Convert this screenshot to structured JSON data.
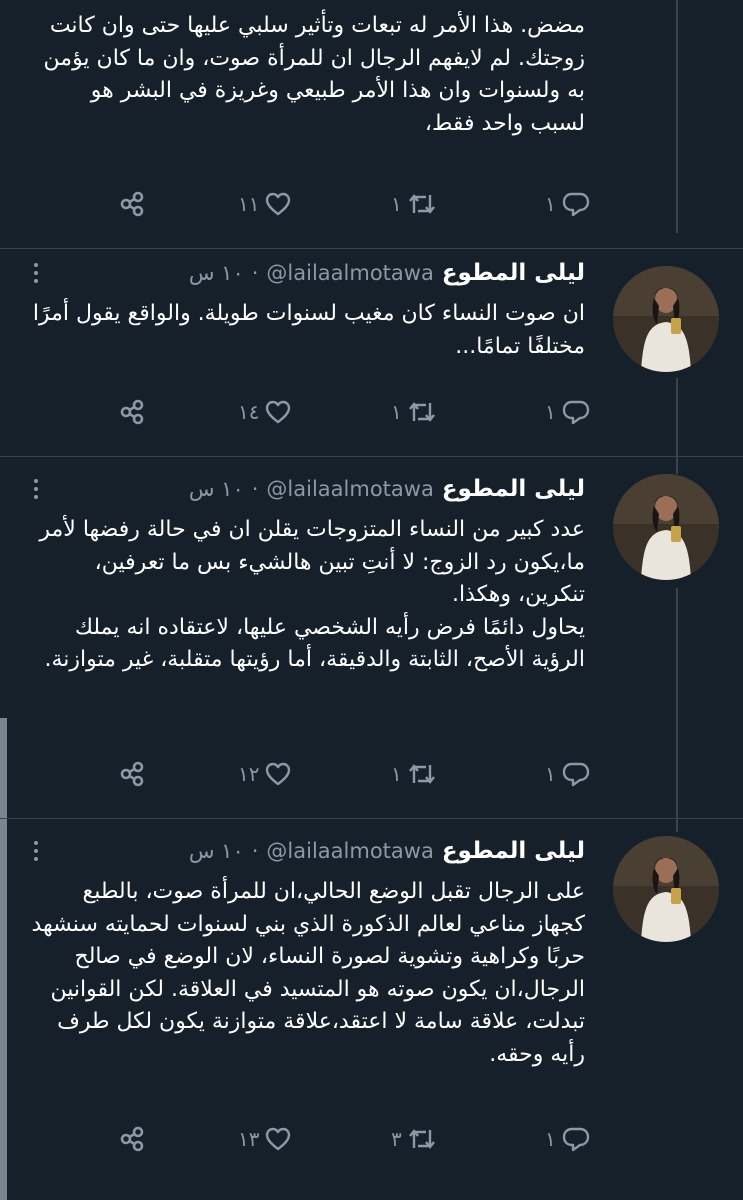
{
  "tweets": [
    {
      "body": [
        "مضض. هذا الأمر له تبعات وتأثير سلبي عليها حتى وان كانت زوجتك. لم لايفهم الرجال ان للمرأة صوت، وان ما كان يؤمن به ولسنوات وان هذا الأمر طبيعي وغريزة في البشر هو لسبب واحد فقط،"
      ],
      "counts": {
        "reply": "١",
        "retweet": "١",
        "like": "١١"
      }
    },
    {
      "name": "ليلى المطوع",
      "handle": "@lailaalmotawa",
      "time": "١٠ س",
      "body": [
        "ان صوت النساء كان مغيب لسنوات طويلة. والواقع يقول أمرًا مختلفًا تمامًا..."
      ],
      "counts": {
        "reply": "١",
        "retweet": "١",
        "like": "١٤"
      }
    },
    {
      "name": "ليلى المطوع",
      "handle": "@lailaalmotawa",
      "time": "١٠ س",
      "body": [
        "عدد كبير من النساء المتزوجات يقلن ان في حالة رفضها لأمر ما،يكون رد الزوج: لا أنتِ تبين هالشيء بس ما تعرفين، تنكرين، وهكذا.",
        "يحاول دائمًا فرض رأيه الشخصي عليها، لاعتقاده انه يملك الرؤية الأصح، الثابتة والدقيقة، أما رؤيتها متقلبة، غير متوازنة."
      ],
      "counts": {
        "reply": "١",
        "retweet": "١",
        "like": "١٢"
      }
    },
    {
      "name": "ليلى المطوع",
      "handle": "@lailaalmotawa",
      "time": "١٠ س",
      "body": [
        "على الرجال تقبل الوضع الحالي،ان للمرأة صوت، بالطبع كجهاز مناعي لعالم الذكورة الذي بني لسنوات لحمايته سنشهد حربًا وكراهية وتشوية لصورة النساء، لان الوضع في صالح الرجال،ان يكون صوته هو المتسيد في العلاقة. لكن القوانين تبدلت، علاقة سامة لا اعتقد،علاقة متوازنة يكون لكل طرف رأيه وحقه."
      ],
      "counts": {
        "reply": "١",
        "retweet": "٣",
        "like": "١٣"
      }
    }
  ],
  "colors": {
    "background": "#15202b",
    "text": "#ffffff",
    "muted": "#8b98a5",
    "divider": "#38444d"
  },
  "icons": [
    "more-icon",
    "reply-icon",
    "retweet-icon",
    "like-icon",
    "share-icon"
  ]
}
